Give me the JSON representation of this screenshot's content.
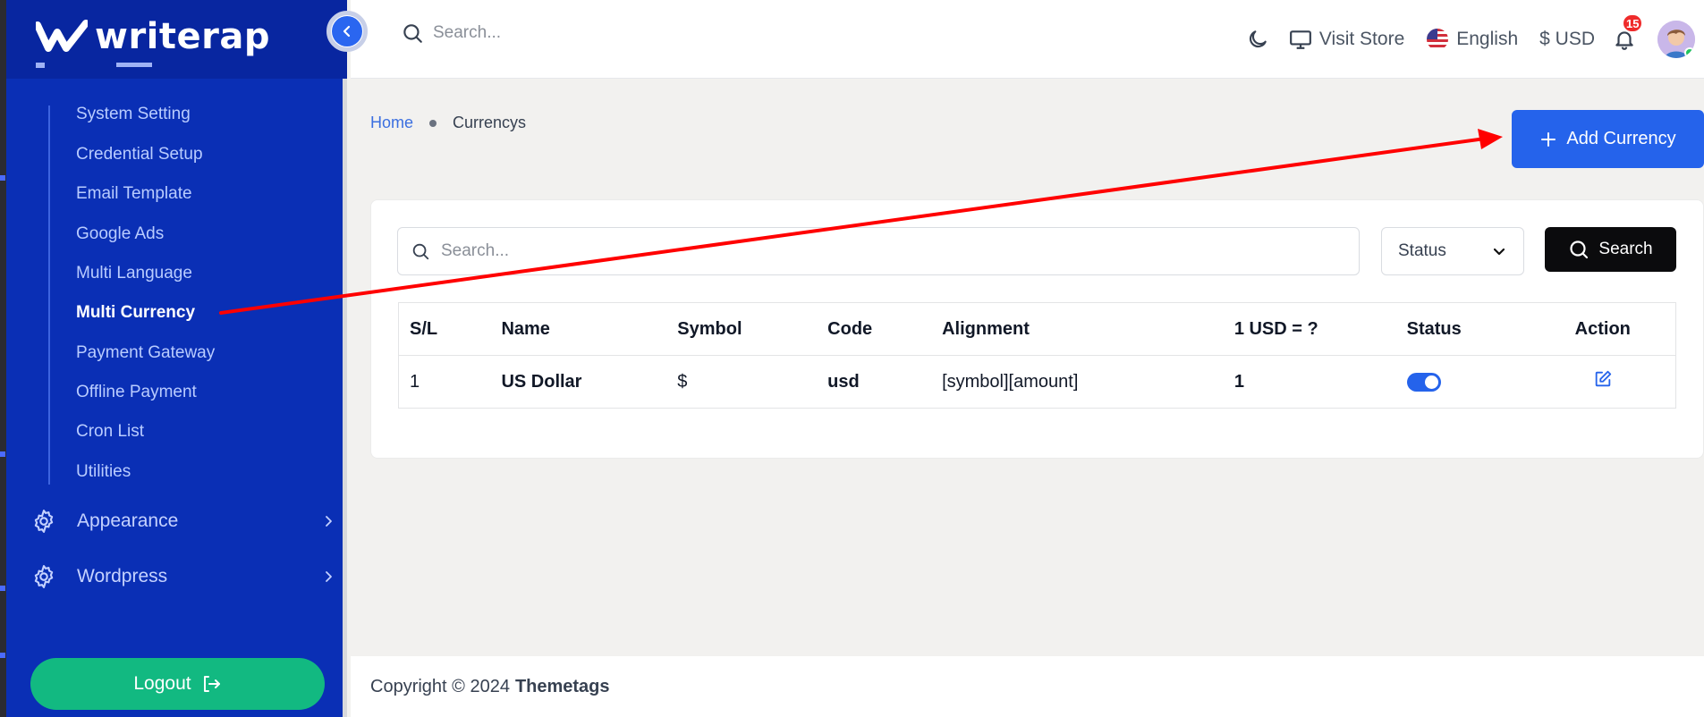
{
  "brand": {
    "logo_text": "writerap"
  },
  "sidebar": {
    "submenu": [
      {
        "label": "System Setting",
        "active": false
      },
      {
        "label": "Credential Setup",
        "active": false
      },
      {
        "label": "Email Template",
        "active": false
      },
      {
        "label": "Google Ads",
        "active": false
      },
      {
        "label": "Multi Language",
        "active": false
      },
      {
        "label": "Multi Currency",
        "active": true
      },
      {
        "label": "Payment Gateway",
        "active": false
      },
      {
        "label": "Offline Payment",
        "active": false
      },
      {
        "label": "Cron List",
        "active": false
      },
      {
        "label": "Utilities",
        "active": false
      }
    ],
    "groups": [
      {
        "label": "Appearance",
        "icon": "gear-icon"
      },
      {
        "label": "Wordpress",
        "icon": "gear-icon"
      }
    ],
    "logout_label": "Logout"
  },
  "header": {
    "search_placeholder": "Search...",
    "visit_store": "Visit Store",
    "language": "English",
    "currency": "$ USD",
    "notification_count": "15"
  },
  "breadcrumb": {
    "home": "Home",
    "current": "Currencys"
  },
  "add_button_label": "Add Currency",
  "filters": {
    "search_placeholder": "Search...",
    "status_label": "Status",
    "search_button_label": "Search"
  },
  "table": {
    "headers": [
      "S/L",
      "Name",
      "Symbol",
      "Code",
      "Alignment",
      "1 USD = ?",
      "Status",
      "Action"
    ],
    "rows": [
      {
        "sl": "1",
        "name": "US Dollar",
        "symbol": "$",
        "code": "usd",
        "alignment": "[symbol][amount]",
        "rate": "1",
        "status_enabled": true
      }
    ]
  },
  "footer": {
    "copyright": "Copyright © 2024",
    "brand": "Themetags"
  },
  "colors": {
    "sidebar": "#0a2fb5",
    "primary": "#2563eb",
    "logout": "#12b981",
    "search_button": "#0b0b0d",
    "annotation_arrow": "#ff0000"
  }
}
